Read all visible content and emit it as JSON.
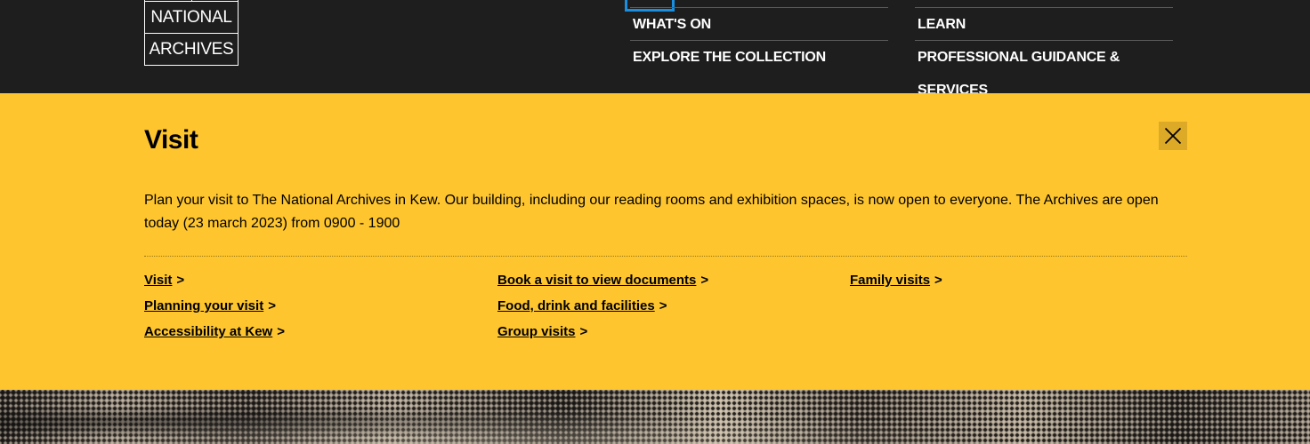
{
  "logo": {
    "line1": "",
    "line2": "NATIONAL",
    "line3": "ARCHIVES"
  },
  "nav": {
    "col1": [
      {
        "label": "WHAT'S ON"
      },
      {
        "label": "EXPLORE THE COLLECTION"
      }
    ],
    "col2": [
      {
        "label": "LEARN"
      },
      {
        "label": "PROFESSIONAL GUIDANCE & SERVICES"
      }
    ]
  },
  "panel": {
    "title": "Visit",
    "close_icon": "close-icon",
    "description": "Plan your visit to The National Archives in Kew. Our building, including our reading rooms and exhibition spaces, is now open to everyone. The Archives are open today (23 march 2023) from 0900 - 1900",
    "chevron": ">",
    "links": {
      "col1": [
        {
          "label": "Visit"
        },
        {
          "label": "Planning your visit"
        },
        {
          "label": "Accessibility at Kew"
        }
      ],
      "col2": [
        {
          "label": "Book a visit to view documents"
        },
        {
          "label": "Food, drink and facilities"
        },
        {
          "label": "Group visits"
        }
      ],
      "col3": [
        {
          "label": "Family visits"
        }
      ]
    }
  },
  "colors": {
    "header_bg": "#1e1e1e",
    "panel_bg": "#fec52e",
    "close_bg": "#ddaa28",
    "focus_outline": "#1a8fe0"
  }
}
